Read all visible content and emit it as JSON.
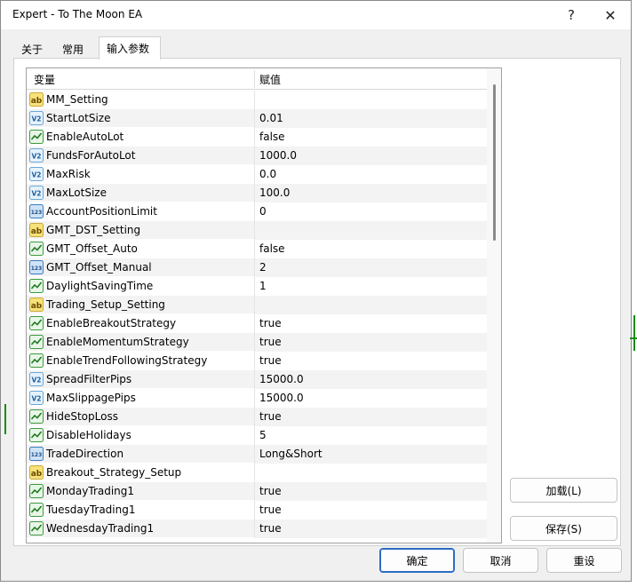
{
  "window": {
    "title": "Expert - To The Moon EA"
  },
  "titlebar": {
    "help_label": "?",
    "close_label": "✕"
  },
  "tabs": [
    {
      "label": "关于",
      "active": false
    },
    {
      "label": "常用",
      "active": false
    },
    {
      "label": "输入参数",
      "active": true
    }
  ],
  "grid": {
    "headers": {
      "variable": "变量",
      "value": "赋值"
    },
    "rows": [
      {
        "type": "ab",
        "name": "MM_Setting",
        "value": ""
      },
      {
        "type": "v2",
        "name": "StartLotSize",
        "value": "0.01"
      },
      {
        "type": "bool",
        "name": "EnableAutoLot",
        "value": "false"
      },
      {
        "type": "v2",
        "name": "FundsForAutoLot",
        "value": "1000.0"
      },
      {
        "type": "v2",
        "name": "MaxRisk",
        "value": "0.0"
      },
      {
        "type": "v2",
        "name": "MaxLotSize",
        "value": "100.0"
      },
      {
        "type": "int",
        "name": "AccountPositionLimit",
        "value": "0"
      },
      {
        "type": "ab",
        "name": "GMT_DST_Setting",
        "value": ""
      },
      {
        "type": "bool",
        "name": "GMT_Offset_Auto",
        "value": "false"
      },
      {
        "type": "int",
        "name": "GMT_Offset_Manual",
        "value": "2"
      },
      {
        "type": "bool",
        "name": "DaylightSavingTime",
        "value": "1"
      },
      {
        "type": "ab",
        "name": "Trading_Setup_Setting",
        "value": ""
      },
      {
        "type": "bool",
        "name": "EnableBreakoutStrategy",
        "value": "true"
      },
      {
        "type": "bool",
        "name": "EnableMomentumStrategy",
        "value": "true"
      },
      {
        "type": "bool",
        "name": "EnableTrendFollowingStrategy",
        "value": "true"
      },
      {
        "type": "v2",
        "name": "SpreadFilterPips",
        "value": "15000.0"
      },
      {
        "type": "v2",
        "name": "MaxSlippagePips",
        "value": "15000.0"
      },
      {
        "type": "bool",
        "name": "HideStopLoss",
        "value": "true"
      },
      {
        "type": "bool",
        "name": "DisableHolidays",
        "value": "5"
      },
      {
        "type": "int",
        "name": "TradeDirection",
        "value": "Long&Short"
      },
      {
        "type": "ab",
        "name": "Breakout_Strategy_Setup",
        "value": ""
      },
      {
        "type": "bool",
        "name": "MondayTrading1",
        "value": "true"
      },
      {
        "type": "bool",
        "name": "TuesdayTrading1",
        "value": "true"
      },
      {
        "type": "bool",
        "name": "WednesdayTrading1",
        "value": "true"
      }
    ]
  },
  "buttons": {
    "load": "加载(L)",
    "save": "保存(S)",
    "ok": "确定",
    "cancel": "取消",
    "reset": "重设"
  },
  "icons": {
    "ab": "string-type-icon",
    "v2": "double-type-icon",
    "bool": "bool-type-icon",
    "int": "integer-type-icon"
  },
  "colors": {
    "accent": "#2b6cc4",
    "grid_stripe": "#f3f3f3",
    "chart_green": "#1a8a1a"
  }
}
